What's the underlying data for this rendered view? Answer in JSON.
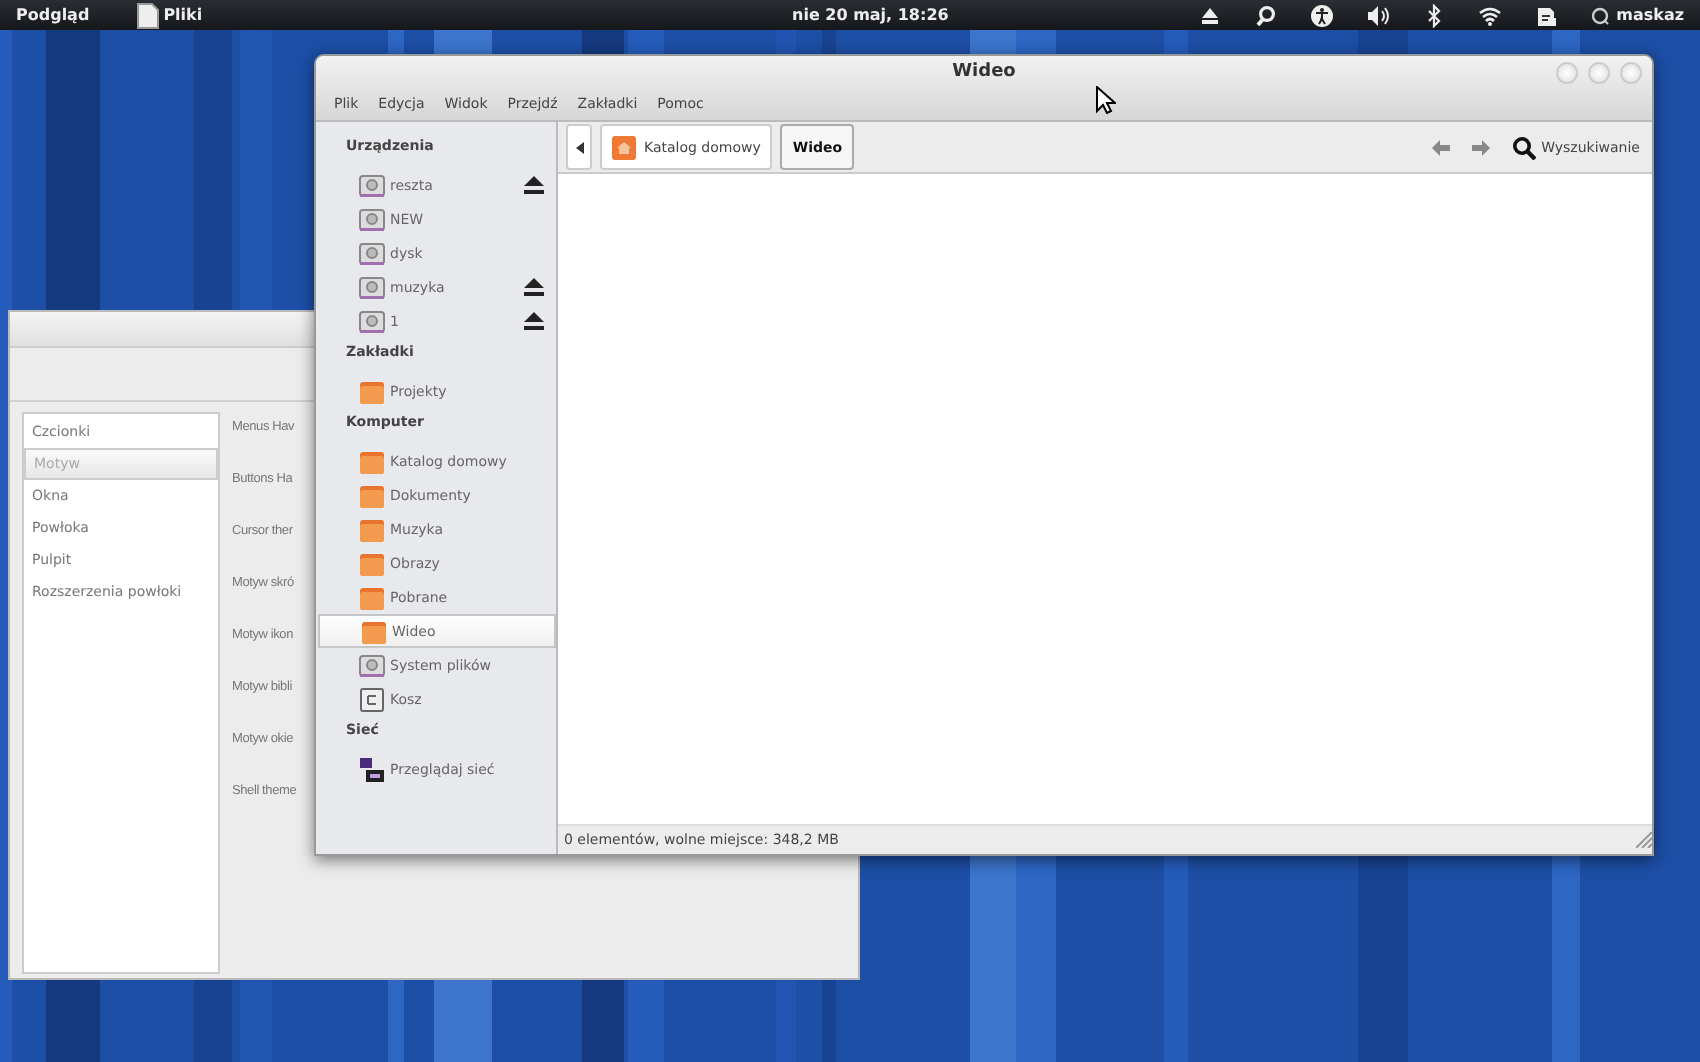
{
  "top_bar": {
    "activities": "Podgląd",
    "app": "Pliki",
    "clock": "nie 20 maj, 18:26",
    "indicators": [
      {
        "kind": "eject"
      },
      {
        "kind": "search"
      },
      {
        "kind": "accessibility"
      },
      {
        "kind": "volume"
      },
      {
        "kind": "bluetooth"
      },
      {
        "kind": "wifi"
      },
      {
        "kind": "clipboard"
      }
    ],
    "user": "maskaz"
  },
  "back_window": {
    "sidebar_items": [
      {
        "label": "Czcionki",
        "selected": false
      },
      {
        "label": "Motyw",
        "selected": true
      },
      {
        "label": "Okna",
        "selected": false
      },
      {
        "label": "Powłoka",
        "selected": false
      },
      {
        "label": "Pulpit",
        "selected": false
      },
      {
        "label": "Rozszerzenia powłoki",
        "selected": false
      }
    ],
    "setting_labels": [
      "Menus Hav",
      "Buttons Ha",
      "Cursor ther",
      "Motyw skró",
      "Motyw ikon",
      "Motyw bibli",
      "Motyw okie",
      "Shell theme"
    ]
  },
  "window": {
    "title": "Wideo",
    "menu": [
      "Plik",
      "Edycja",
      "Widok",
      "Przejdź",
      "Zakładki",
      "Pomoc"
    ],
    "sidebar": [
      {
        "heading": "Urządzenia",
        "items": [
          {
            "label": "reszta",
            "kind": "drive",
            "eject": true,
            "selected": false
          },
          {
            "label": "NEW",
            "kind": "drive",
            "eject": false,
            "selected": false
          },
          {
            "label": "dysk",
            "kind": "drive",
            "eject": false,
            "selected": false
          },
          {
            "label": "muzyka",
            "kind": "drive",
            "eject": true,
            "selected": false
          },
          {
            "label": "1",
            "kind": "drive",
            "eject": true,
            "selected": false
          }
        ]
      },
      {
        "heading": "Zakładki",
        "items": [
          {
            "label": "Projekty",
            "kind": "folder",
            "eject": false,
            "selected": false
          }
        ]
      },
      {
        "heading": "Komputer",
        "items": [
          {
            "label": "Katalog domowy",
            "kind": "folder",
            "eject": false,
            "selected": false
          },
          {
            "label": "Dokumenty",
            "kind": "folder",
            "eject": false,
            "selected": false
          },
          {
            "label": "Muzyka",
            "kind": "folder",
            "eject": false,
            "selected": false
          },
          {
            "label": "Obrazy",
            "kind": "folder",
            "eject": false,
            "selected": false
          },
          {
            "label": "Pobrane",
            "kind": "folder",
            "eject": false,
            "selected": false
          },
          {
            "label": "Wideo",
            "kind": "folder",
            "eject": false,
            "selected": true
          },
          {
            "label": "System plików",
            "kind": "drive",
            "eject": false,
            "selected": false
          },
          {
            "label": "Kosz",
            "kind": "trash",
            "eject": false,
            "selected": false
          }
        ]
      },
      {
        "heading": "Sieć",
        "items": [
          {
            "label": "Przeglądaj sieć",
            "kind": "network",
            "eject": false,
            "selected": false
          }
        ]
      }
    ],
    "path": [
      {
        "label": "Katalog domowy",
        "selected": false
      },
      {
        "label": "Wideo",
        "selected": true
      }
    ],
    "search": "Wyszukiwanie",
    "status": "0 elementów, wolne miejsce: 348,2 MB"
  }
}
